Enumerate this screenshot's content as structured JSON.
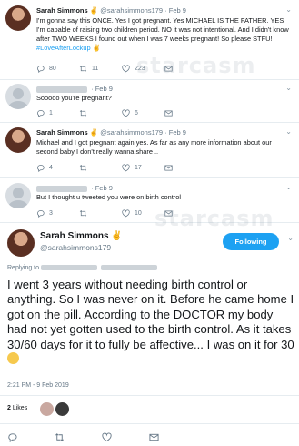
{
  "tweets": [
    {
      "name": "Sarah Simmons ✌",
      "handle": "@sarahsimmons179",
      "date": "Feb 9",
      "text": "I'm gonna say this ONCE. Yes I got pregnant. Yes MICHAEL IS THE FATHER. YES I'm capable of raising two children period. NO it was not intentional. And I didn't know after TWO WEEKS I found out when I was 7 weeks pregnant! So please STFU!",
      "hashtag": "#LoveAfterLockup",
      "emoji": "✌",
      "replies": "80",
      "retweets": "11",
      "likes": "223"
    },
    {
      "date": "Feb 9",
      "text": "Sooooo you're pregnant?",
      "replies": "1",
      "retweets": "",
      "likes": "6"
    },
    {
      "name": "Sarah Simmons ✌",
      "handle": "@sarahsimmons179",
      "date": "Feb 9",
      "text": "Michael and I got pregnant again yes. As far as any more information about our second baby I don't really wanna share ..",
      "replies": "4",
      "retweets": "",
      "likes": "17"
    },
    {
      "date": "Feb 9",
      "text": "But I thought u tweeted you were on birth control",
      "replies": "3",
      "retweets": "",
      "likes": "10"
    }
  ],
  "main": {
    "name": "Sarah Simmons ✌",
    "handle": "@sarahsimmons179",
    "follow_label": "Following",
    "replying_label": "Replying to",
    "text": "I went 3 years without needing birth control or anything. So I was never on it. Before he came home I got on the pill. According to the DOCTOR my body had not yet gotten used to the birth control. As it takes 30/60 days for it to fully be affective... I was on it for 30",
    "timestamp": "2:21 PM - 9 Feb 2019",
    "likes_count": "2",
    "likes_label": "Likes"
  },
  "watermark": "starcasm",
  "colors": {
    "accent": "#1da1f2",
    "text": "#14171a",
    "muted": "#657786",
    "border": "#e6ecf0"
  },
  "icons": [
    "reply-icon",
    "retweet-icon",
    "heart-icon",
    "mail-icon",
    "chevron-down-icon"
  ]
}
